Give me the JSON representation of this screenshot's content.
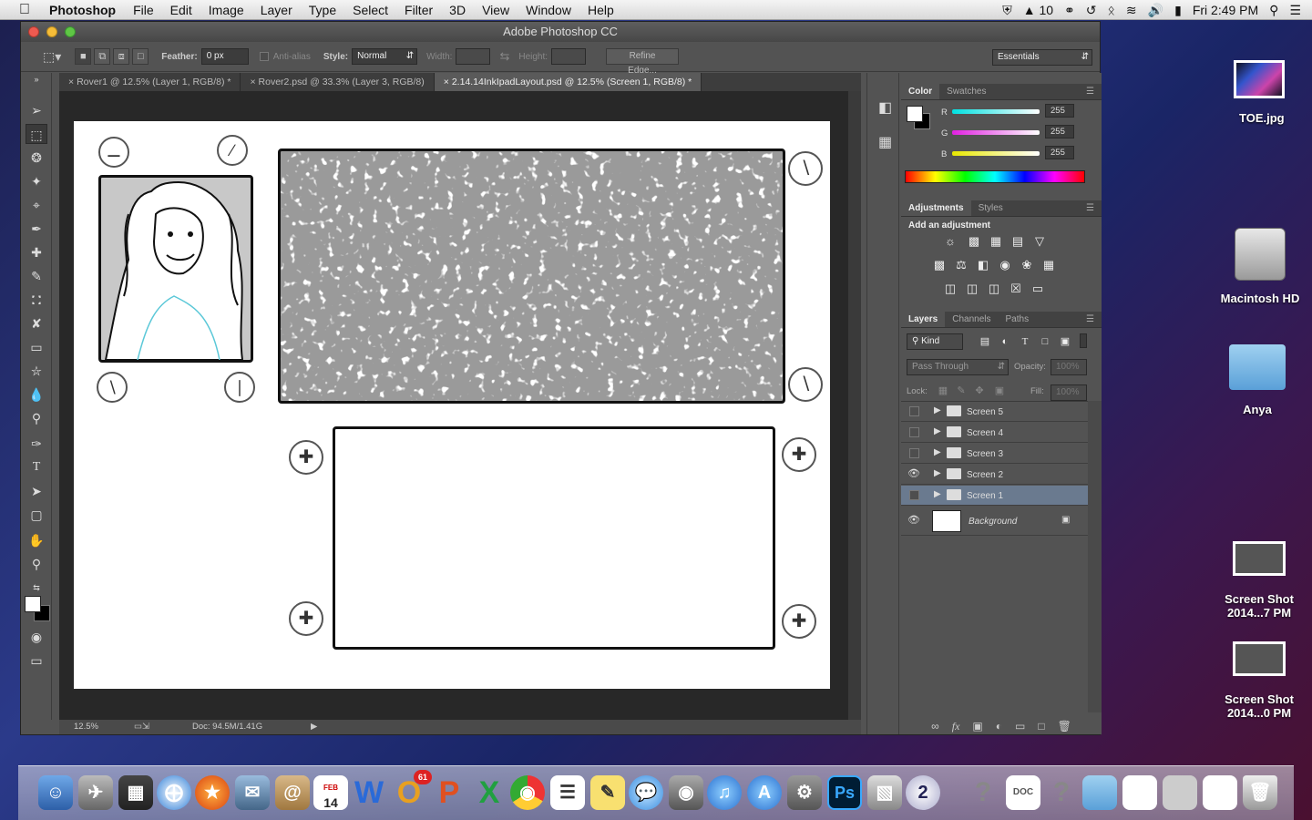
{
  "menubar": {
    "app_name": "Photoshop",
    "items": [
      "File",
      "Edit",
      "Image",
      "Layer",
      "Type",
      "Select",
      "Filter",
      "3D",
      "View",
      "Window",
      "Help"
    ],
    "status_number": "10",
    "clock": "Fri 2:49 PM"
  },
  "window": {
    "title": "Adobe Photoshop CC"
  },
  "options": {
    "feather_label": "Feather:",
    "feather_value": "0 px",
    "antialias_label": "Anti-alias",
    "style_label": "Style:",
    "style_value": "Normal",
    "width_label": "Width:",
    "height_label": "Height:",
    "refine_edge": "Refine Edge...",
    "workspace": "Essentials"
  },
  "tabs": [
    {
      "label": "Rover1 @ 12.5% (Layer 1, RGB/8) *"
    },
    {
      "label": "Rover2.psd @ 33.3% (Layer 3, RGB/8)"
    },
    {
      "label": "2.14.14InkIpadLayout.psd @ 12.5% (Screen 1, RGB/8) *"
    }
  ],
  "status": {
    "zoom": "12.5%",
    "doc": "Doc: 94.5M/1.41G"
  },
  "color_panel": {
    "tabs": [
      "Color",
      "Swatches"
    ],
    "channels": [
      {
        "label": "R",
        "value": "255",
        "color": "#00e0e0"
      },
      {
        "label": "G",
        "value": "255",
        "color": "#e020e0"
      },
      {
        "label": "B",
        "value": "255",
        "color": "#e8e800"
      }
    ]
  },
  "adjustments": {
    "tabs": [
      "Adjustments",
      "Styles"
    ],
    "heading": "Add an adjustment"
  },
  "layers_panel": {
    "tabs": [
      "Layers",
      "Channels",
      "Paths"
    ],
    "kind": "Kind",
    "blend": "Pass Through",
    "opacity_label": "Opacity:",
    "opacity_value": "100%",
    "lock_label": "Lock:",
    "fill_label": "Fill:",
    "fill_value": "100%",
    "layers": [
      {
        "name": "Screen 5",
        "visible": false,
        "selected": false
      },
      {
        "name": "Screen 4",
        "visible": false,
        "selected": false
      },
      {
        "name": "Screen 3",
        "visible": false,
        "selected": false
      },
      {
        "name": "Screen 2",
        "visible": true,
        "selected": false
      },
      {
        "name": "Screen 1",
        "visible": false,
        "selected": true
      }
    ],
    "background": "Background"
  },
  "desktop": {
    "icons": [
      {
        "label": "TOE.jpg"
      },
      {
        "label": "Macintosh HD"
      },
      {
        "label": "Anya"
      },
      {
        "label": "Screen Shot\n2014...7 PM"
      },
      {
        "label": "Screen Shot\n2014...0 PM"
      }
    ]
  },
  "dock": {
    "ps_label": "Ps",
    "calendar_day": "14",
    "calendar_month": "FEB",
    "badge": "61",
    "clock_num": "2"
  }
}
